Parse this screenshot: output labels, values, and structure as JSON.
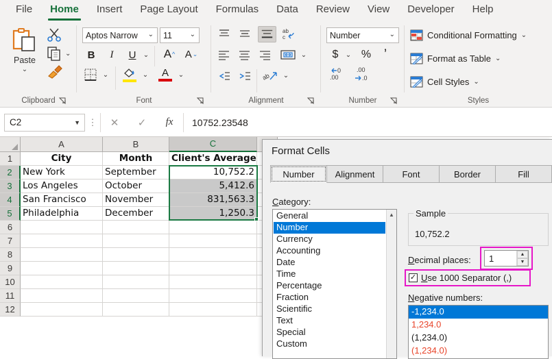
{
  "ribbon": {
    "tabs": [
      {
        "label": "File",
        "active": false
      },
      {
        "label": "Home",
        "active": true
      },
      {
        "label": "Insert",
        "active": false
      },
      {
        "label": "Page Layout",
        "active": false
      },
      {
        "label": "Formulas",
        "active": false
      },
      {
        "label": "Data",
        "active": false
      },
      {
        "label": "Review",
        "active": false
      },
      {
        "label": "View",
        "active": false
      },
      {
        "label": "Developer",
        "active": false
      },
      {
        "label": "Help",
        "active": false
      }
    ],
    "groups": {
      "clipboard": {
        "label": "Clipboard",
        "paste_label": "Paste",
        "cut_icon": "scissors-icon",
        "copy_icon": "copy-icon",
        "format_painter_icon": "format-painter-icon"
      },
      "font": {
        "label": "Font",
        "font_name": "Aptos Narrow",
        "font_size": "11",
        "bold": "B",
        "italic": "I",
        "underline": "U",
        "grow_font": "A",
        "shrink_font": "A",
        "borders_icon": "borders-icon",
        "fill_color_icon": "fill-color-icon",
        "font_color_icon": "font-color-icon",
        "fill_color": "#ffe600",
        "font_color": "#d8000c"
      },
      "alignment": {
        "label": "Alignment",
        "wrap_text_icon": "wrap-text-icon",
        "merge_center_icon": "merge-and-center-icon",
        "orientation_icon": "orientation-icon"
      },
      "number": {
        "label": "Number",
        "format_value": "Number",
        "currency": "$",
        "percent": "%",
        "comma": "’",
        "increase_decimal_icon": "increase-decimal-icon",
        "decrease_decimal_icon": "decrease-decimal-icon"
      },
      "styles": {
        "label": "Styles",
        "items": [
          {
            "label": "Conditional Formatting",
            "icon": "conditional-formatting-icon"
          },
          {
            "label": "Format as Table",
            "icon": "format-as-table-icon"
          },
          {
            "label": "Cell Styles",
            "icon": "cell-styles-icon"
          }
        ]
      }
    }
  },
  "formula_bar": {
    "name_box": "C2",
    "cancel_icon": "cancel-icon",
    "enter_icon": "enter-icon",
    "fx_icon": "fx-icon",
    "formula": "10752.23548"
  },
  "sheet": {
    "columns": [
      "A",
      "B",
      "C"
    ],
    "selected_column": "C",
    "rows": [
      "1",
      "2",
      "3",
      "4",
      "5",
      "6",
      "7",
      "8",
      "9",
      "10",
      "11",
      "12"
    ],
    "selected_rows": [
      "2",
      "3",
      "4",
      "5"
    ],
    "header_row": [
      "City",
      "Month",
      "Client's Average"
    ],
    "data_rows": [
      {
        "city": "New York",
        "month": "September",
        "average": "10,752.2"
      },
      {
        "city": "Los Angeles",
        "month": "October",
        "average": "5,412.6"
      },
      {
        "city": "San Francisco",
        "month": "November",
        "average": "831,563.3"
      },
      {
        "city": "Philadelphia",
        "month": "December",
        "average": "1,250.3"
      }
    ],
    "selection_color": "#1b7a43"
  },
  "dialog": {
    "title": "Format Cells",
    "tabs": [
      {
        "label": "Number",
        "active": true
      },
      {
        "label": "Alignment",
        "active": false
      },
      {
        "label": "Font",
        "active": false
      },
      {
        "label": "Border",
        "active": false
      },
      {
        "label": "Fill",
        "active": false
      }
    ],
    "category_label": "Category:",
    "categories": [
      "General",
      "Number",
      "Currency",
      "Accounting",
      "Date",
      "Time",
      "Percentage",
      "Fraction",
      "Scientific",
      "Text",
      "Special",
      "Custom"
    ],
    "selected_category": "Number",
    "sample_label": "Sample",
    "sample_value": "10,752.2",
    "decimal_places_label": "Decimal places:",
    "decimal_places_value": "1",
    "use_separator_label": "Use 1000 Separator (,)",
    "use_separator_checked": true,
    "negative_numbers_label": "Negative numbers:",
    "negative_numbers": [
      {
        "text": "-1,234.0",
        "color": "#ffffff",
        "selected": true
      },
      {
        "text": "1,234.0",
        "color": "#e8442a",
        "selected": false
      },
      {
        "text": "(1,234.0)",
        "color": "#1b1b1b",
        "selected": false
      },
      {
        "text": "(1,234.0)",
        "color": "#e8442a",
        "selected": false
      }
    ],
    "highlight_color": "#e617c8"
  }
}
